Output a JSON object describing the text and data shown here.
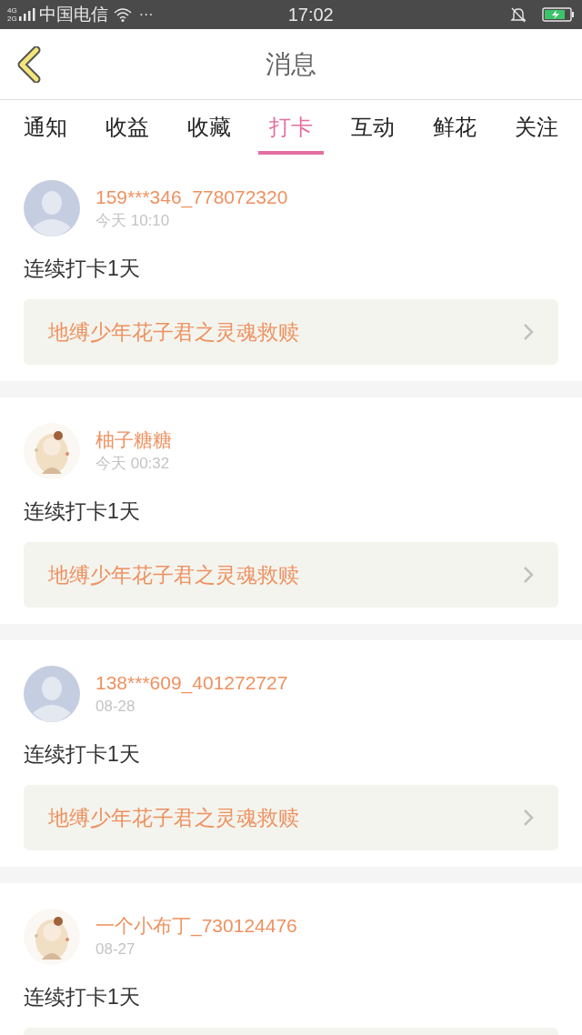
{
  "status_bar": {
    "network_top": "4G",
    "network_bottom": "2G",
    "carrier": "中国电信",
    "more": "···",
    "time": "17:02"
  },
  "header": {
    "title": "消息"
  },
  "tabs": [
    {
      "label": "通知",
      "selected": false
    },
    {
      "label": "收益",
      "selected": false
    },
    {
      "label": "收藏",
      "selected": false
    },
    {
      "label": "打卡",
      "selected": true
    },
    {
      "label": "互动",
      "selected": false
    },
    {
      "label": "鲜花",
      "selected": false
    },
    {
      "label": "关注",
      "selected": false
    }
  ],
  "messages": [
    {
      "kind": "silhouette",
      "name": "159***346_778072320",
      "time": "今天 10:10",
      "text": "连续打卡1天",
      "link": "地缚少年花子君之灵魂救赎"
    },
    {
      "kind": "picture",
      "name": "柚子糖糖",
      "time": "今天 00:32",
      "text": "连续打卡1天",
      "link": "地缚少年花子君之灵魂救赎"
    },
    {
      "kind": "silhouette",
      "name": "138***609_401272727",
      "time": "08-28",
      "text": "连续打卡1天",
      "link": "地缚少年花子君之灵魂救赎"
    },
    {
      "kind": "picture",
      "name": "一个小布丁_730124476",
      "time": "08-27",
      "text": "连续打卡1天"
    }
  ]
}
